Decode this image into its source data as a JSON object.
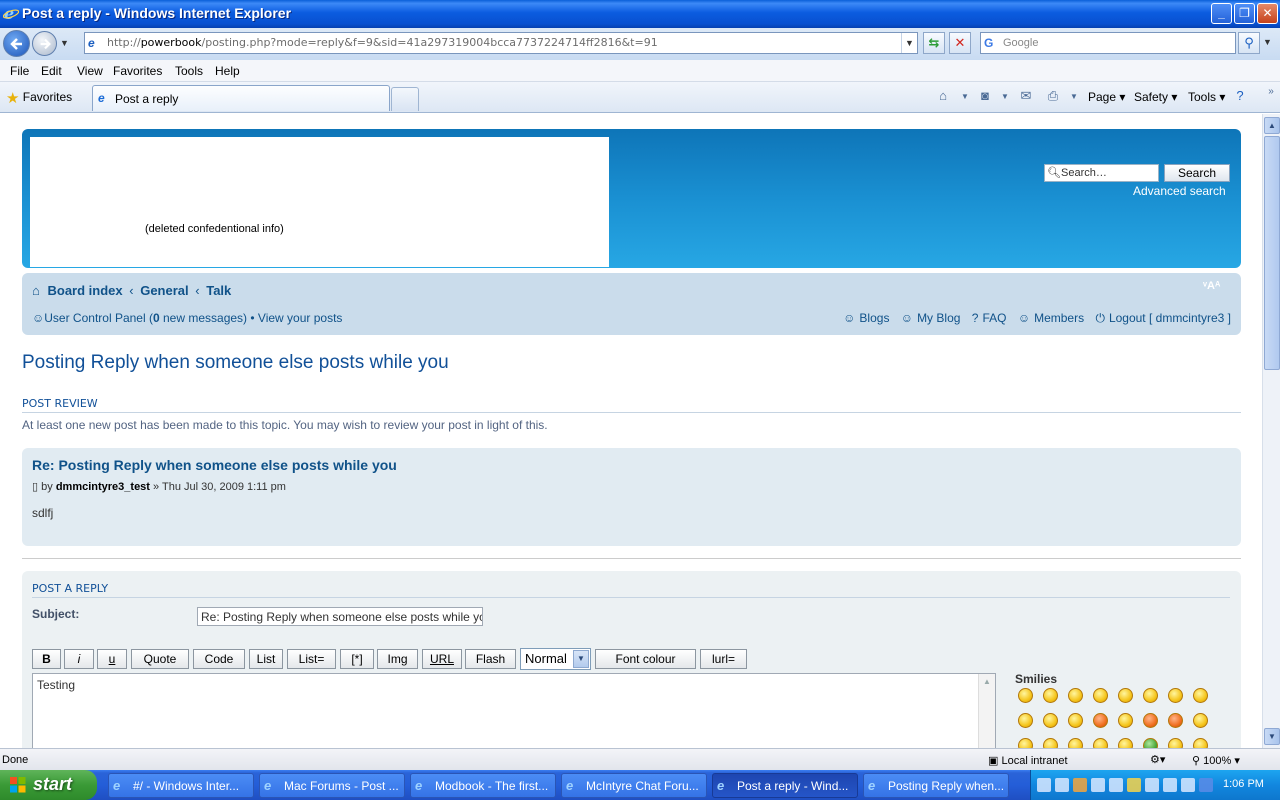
{
  "window": {
    "title": "Post a reply - Windows Internet Explorer",
    "buttons": {
      "minimize": "_",
      "maximize": "❐",
      "close": "✕"
    }
  },
  "navbar": {
    "url_prefix": "http://",
    "url_host": "powerbook",
    "url_path": "/posting.php?mode=reply&f=9&sid=41a297319004bcca7737224714ff2816&t=91",
    "search_placeholder": "Google"
  },
  "menu": [
    "File",
    "Edit",
    "View",
    "Favorites",
    "Tools",
    "Help"
  ],
  "favbar": {
    "favorites_label": "Favorites",
    "tab_label": "Post a reply",
    "commands": {
      "page": "Page ▾",
      "safety": "Safety ▾",
      "tools": "Tools ▾"
    }
  },
  "site": {
    "logo_text": "(deleted confedentional info)",
    "search_placeholder": "Search…",
    "search_button": "Search",
    "advanced_search": "Advanced search",
    "fontsize_ctrl": "ᵛAᴬ",
    "breadcrumbs": [
      "Board index",
      "General",
      "Talk"
    ],
    "ucp": {
      "label_start": "User Control Panel (",
      "count": "0",
      "label_end": " new messages) • View your posts"
    },
    "right_links": [
      "Blogs",
      "My Blog",
      "FAQ",
      "Members",
      "Logout [ dmmcintyre3 ]"
    ]
  },
  "page": {
    "heading": "Posting Reply when someone else posts while you",
    "post_review_title": "Post review",
    "post_review_msg": "At least one new post has been made to this topic. You may wish to review your post in light of this.",
    "review_post": {
      "title": "Re: Posting Reply when someone else posts while you",
      "by": "by ",
      "author": "dmmcintyre3_test",
      "date": " » Thu Jul 30, 2009 1:11 pm",
      "body": "sdlfj"
    },
    "reply": {
      "title": "Post a reply",
      "subject_label": "Subject:",
      "subject_value": "Re: Posting Reply when someone else posts while you",
      "bbcode_buttons": [
        "B",
        "i",
        "u",
        "Quote",
        "Code",
        "List",
        "List=",
        "[*]",
        "Img",
        "URL",
        "Flash"
      ],
      "size_select": "Normal",
      "font_colour": "Font colour",
      "url_eq": "lurl=",
      "message": "Testing",
      "smilies_label": "Smilies"
    }
  },
  "statusbar": {
    "status": "Done",
    "zone": "Local intranet",
    "zoom": "100%"
  },
  "taskbar": {
    "start": "start",
    "tasks": [
      "#/ - Windows Inter...",
      "Mac Forums - Post ...",
      "Modbook - The first...",
      "McIntyre Chat Foru...",
      "Post a reply - Wind...",
      "Posting Reply when..."
    ],
    "active_task": 4,
    "clock": "1:06 PM"
  }
}
